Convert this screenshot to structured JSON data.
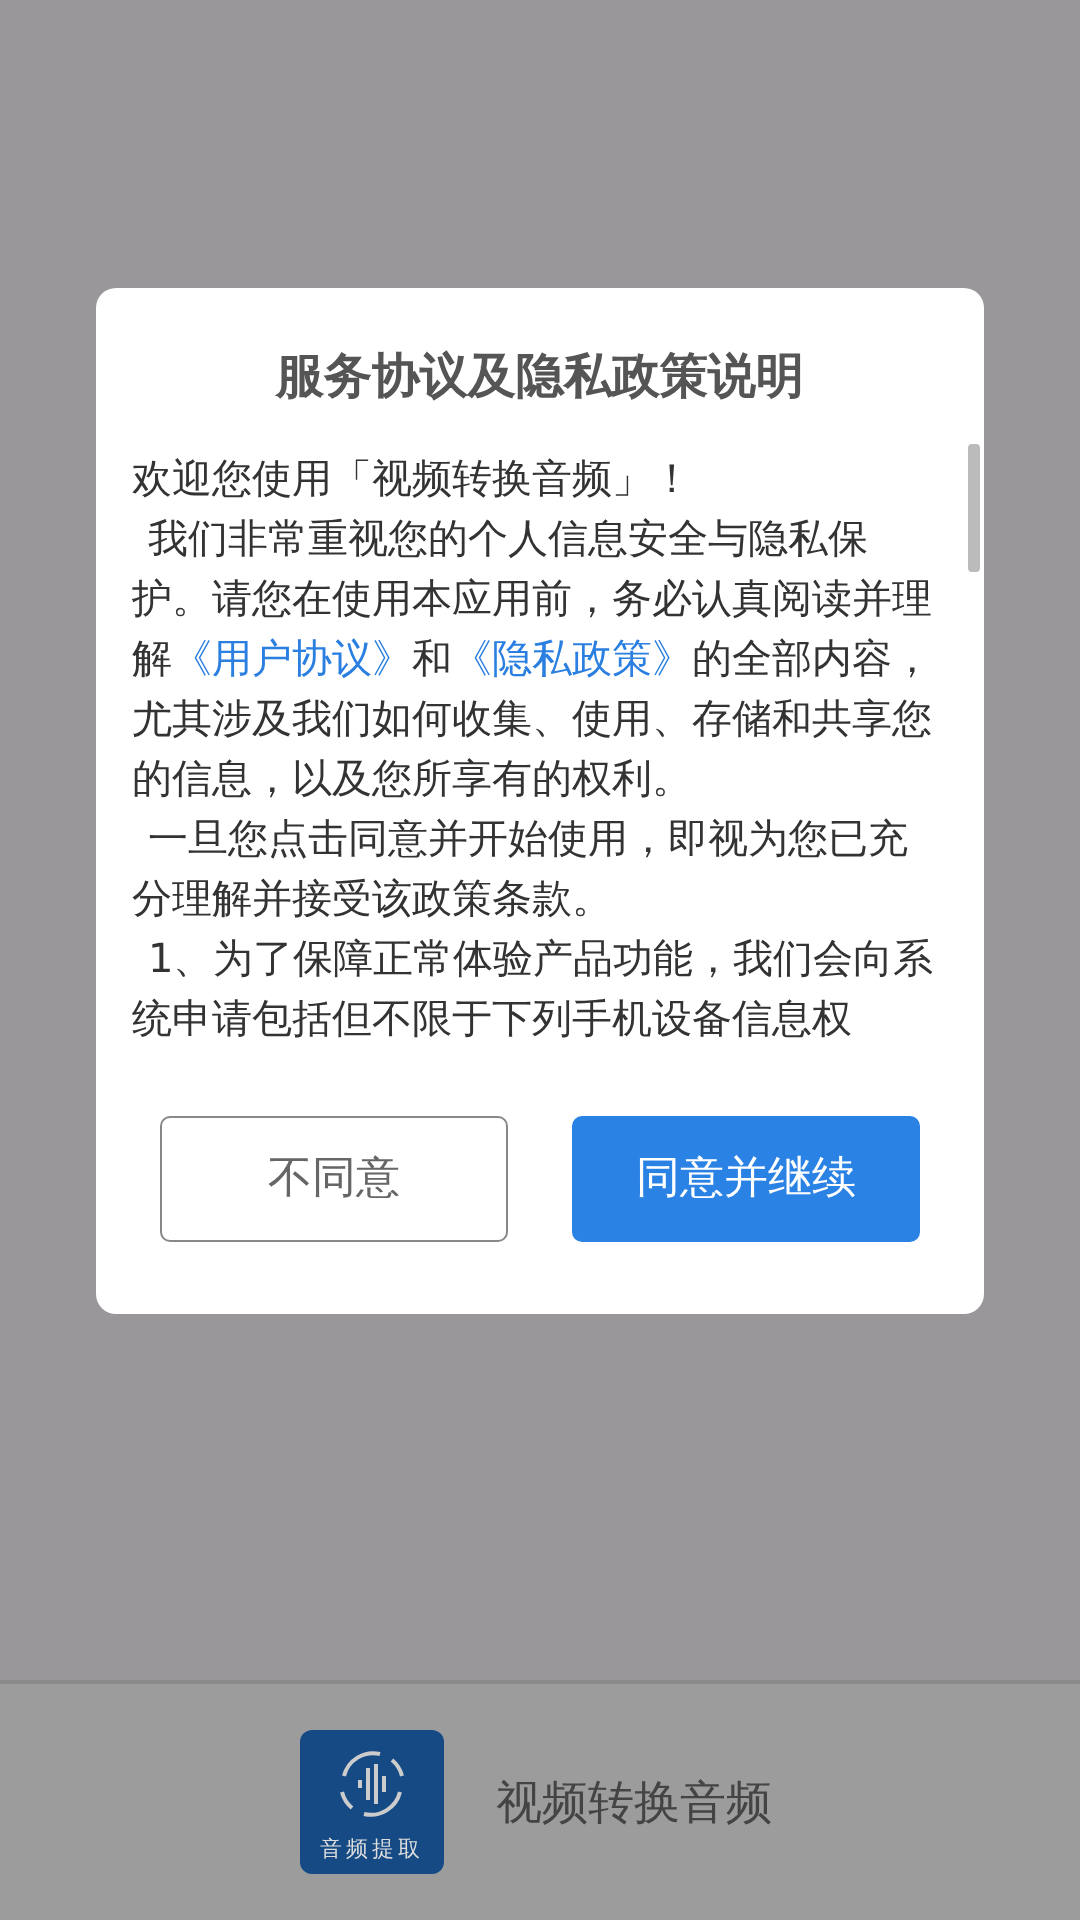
{
  "dialog": {
    "title": "服务协议及隐私政策说明",
    "paragraphs": [
      {
        "segments": [
          {
            "kind": "text",
            "text": "欢迎您使用「视频转换音频」！"
          }
        ]
      },
      {
        "segments": [
          {
            "kind": "text",
            "text": "我们非常重视您的个人信息安全与隐私保护。请您在使用本应用前，务必认真阅读并理解"
          },
          {
            "kind": "link",
            "text": "《用户协议》"
          },
          {
            "kind": "text",
            "text": "和"
          },
          {
            "kind": "link",
            "text": "《隐私政策》"
          },
          {
            "kind": "text",
            "text": "的全部内容，尤其涉及我们如何收集、使用、存储和共享您的信息，以及您所享有的权利。"
          }
        ]
      },
      {
        "segments": [
          {
            "kind": "text",
            "text": "一旦您点击同意并开始使用，即视为您已充分理解并接受该政策条款。"
          }
        ]
      },
      {
        "segments": [
          {
            "kind": "text",
            "text": "1、为了保障正常体验产品功能，我们会向系统申请包括但不限于下列手机设备信息权"
          }
        ]
      }
    ],
    "buttons": [
      {
        "label": "不同意",
        "kind": "secondary"
      },
      {
        "label": "同意并继续",
        "kind": "primary"
      }
    ]
  },
  "app_bar": {
    "icon_caption": "音频提取",
    "app_name": "视频转换音频"
  }
}
